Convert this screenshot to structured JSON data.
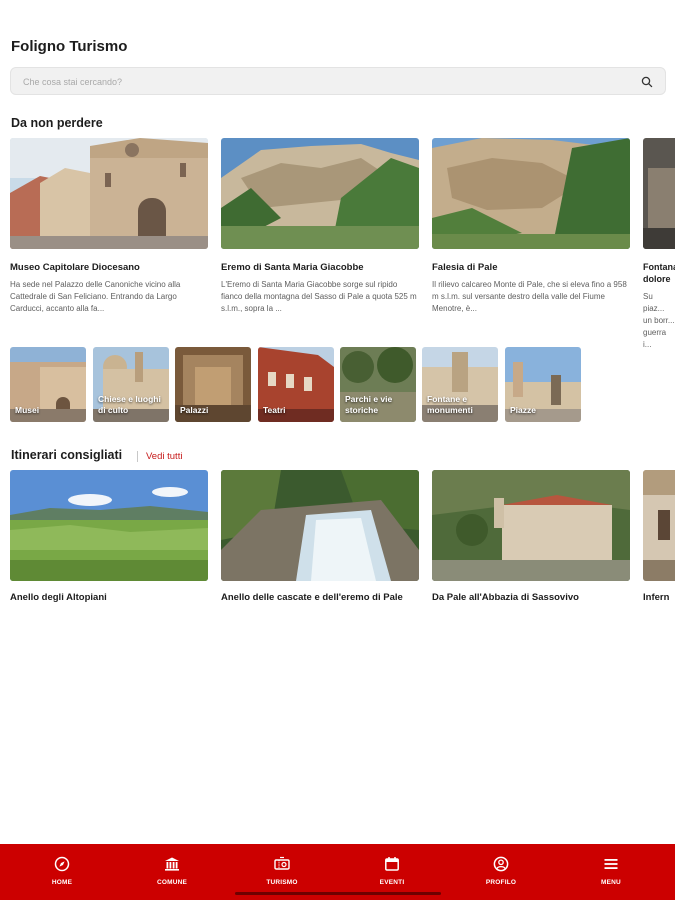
{
  "app": {
    "title": "Foligno Turismo"
  },
  "search": {
    "placeholder": "Che cosa stai cercando?",
    "icon": "search-icon"
  },
  "featured": {
    "title": "Da non perdere",
    "cards": [
      {
        "title": "Museo Capitolare Diocesano",
        "description": "Ha sede nel Palazzo delle Canoniche vicino alla Cattedrale di San Feliciano. Entrando da Largo Carducci, accanto alla fa..."
      },
      {
        "title": "Eremo di Santa Maria Giacobbe",
        "description": "L'Eremo di Santa Maria Giacobbe sorge sul ripido fianco della montagna del Sasso di Pale a quota 525 m s.l.m., sopra la ..."
      },
      {
        "title": "Falesia di Pale",
        "description": "Il rilievo calcareo Monte di Pale, che si eleva fino a 958 m s.l.m. sul versante destro della valle del Fiume Menotre, è..."
      },
      {
        "title": "Fontana dolore",
        "description": "Su piaz... un borr... guerra i..."
      }
    ]
  },
  "categories": [
    {
      "label": "Musei"
    },
    {
      "label": "Chiese e luoghi di culto"
    },
    {
      "label": "Palazzi"
    },
    {
      "label": "Teatri"
    },
    {
      "label": "Parchi e vie storiche"
    },
    {
      "label": "Fontane e monumenti"
    },
    {
      "label": "Piazze"
    }
  ],
  "itineraries": {
    "title": "Itinerari consigliati",
    "see_all": "Vedi tutti",
    "cards": [
      {
        "title": "Anello degli Altopiani"
      },
      {
        "title": "Anello delle cascate e dell'eremo di Pale"
      },
      {
        "title": "Da Pale all'Abbazia di Sassovivo"
      },
      {
        "title": "Infern"
      }
    ]
  },
  "navbar": {
    "color": "#cc0000",
    "items": [
      {
        "label": "HOME",
        "icon": "compass-icon"
      },
      {
        "label": "COMUNE",
        "icon": "town-hall-icon"
      },
      {
        "label": "TURISMO",
        "icon": "ticket-icon"
      },
      {
        "label": "EVENTI",
        "icon": "calendar-icon"
      },
      {
        "label": "PROFILO",
        "icon": "user-circle-icon"
      },
      {
        "label": "MENU",
        "icon": "hamburger-icon"
      }
    ]
  }
}
